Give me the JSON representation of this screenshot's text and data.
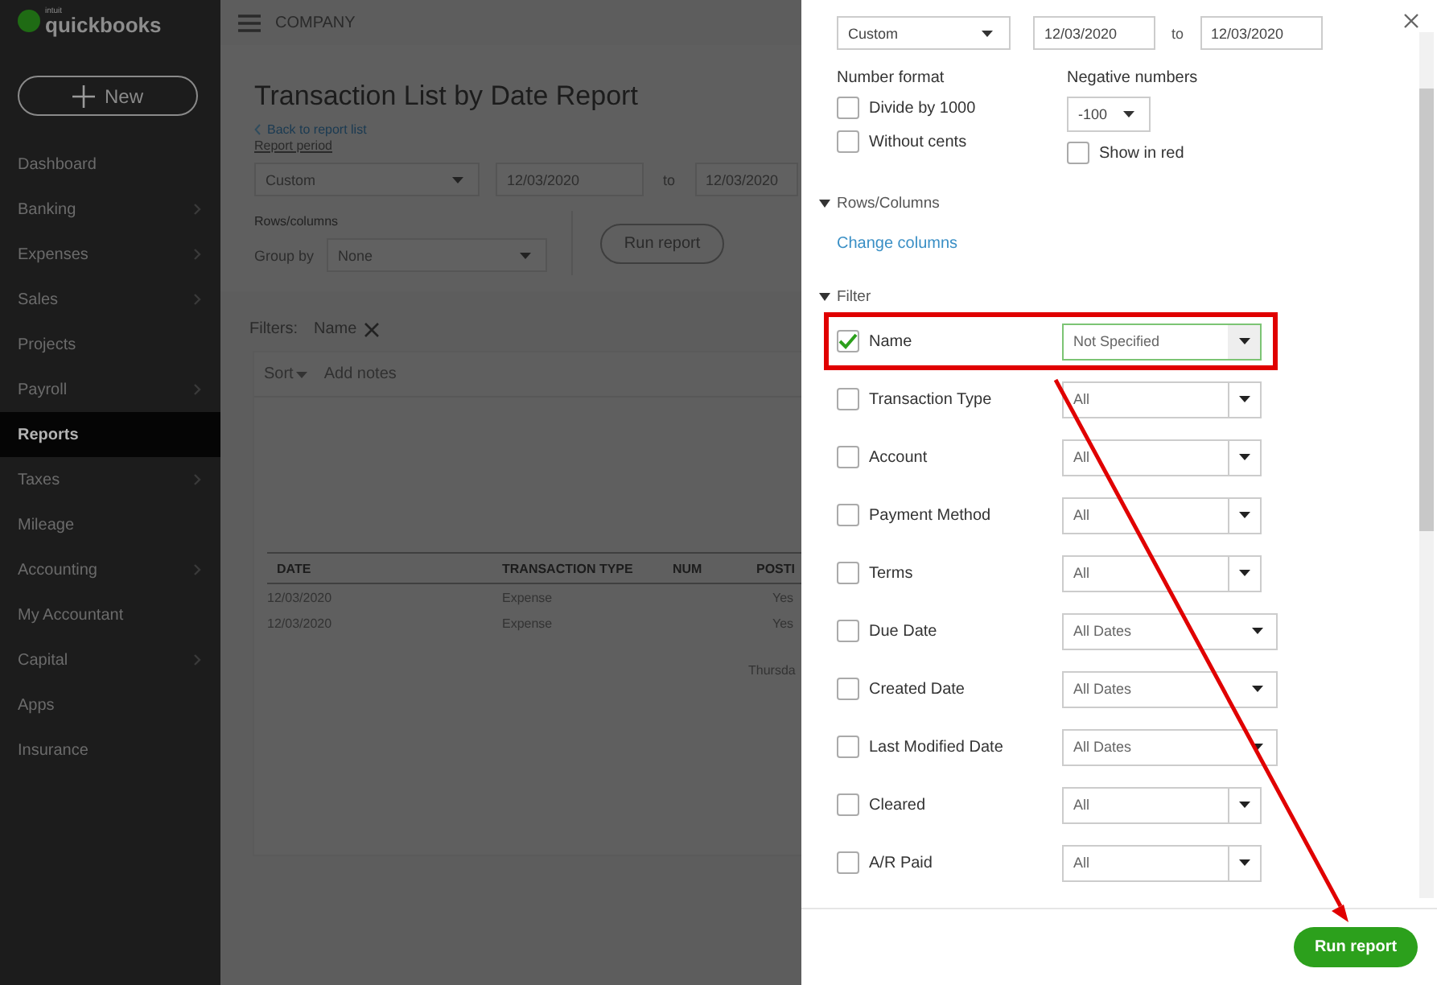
{
  "app": {
    "logo_small": "intuit",
    "logo": "quickbooks",
    "new_button": "New"
  },
  "sidebar": {
    "items": [
      {
        "label": "Dashboard",
        "submenu": false,
        "selected": false
      },
      {
        "label": "Banking",
        "submenu": true,
        "selected": false
      },
      {
        "label": "Expenses",
        "submenu": true,
        "selected": false
      },
      {
        "label": "Sales",
        "submenu": true,
        "selected": false
      },
      {
        "label": "Projects",
        "submenu": false,
        "selected": false
      },
      {
        "label": "Payroll",
        "submenu": true,
        "selected": false
      },
      {
        "label": "Reports",
        "submenu": false,
        "selected": true
      },
      {
        "label": "Taxes",
        "submenu": true,
        "selected": false
      },
      {
        "label": "Mileage",
        "submenu": false,
        "selected": false
      },
      {
        "label": "Accounting",
        "submenu": true,
        "selected": false
      },
      {
        "label": "My Accountant",
        "submenu": false,
        "selected": false
      },
      {
        "label": "Capital",
        "submenu": true,
        "selected": false
      },
      {
        "label": "Apps",
        "submenu": false,
        "selected": false
      },
      {
        "label": "Insurance",
        "submenu": false,
        "selected": false
      }
    ]
  },
  "topbar": {
    "company": "COMPANY"
  },
  "report": {
    "title": "Transaction List by Date Report",
    "back_link": "Back to report list",
    "period_label": "Report period",
    "period": "Custom",
    "from": "12/03/2020",
    "to_label": "to",
    "to": "12/03/2020",
    "rows_columns_label": "Rows/columns",
    "group_by_label": "Group by",
    "group_by": "None",
    "run_button": "Run report",
    "filters_label": "Filters:",
    "filter_chip": "Name",
    "sort": "Sort",
    "add_notes": "Add notes",
    "table": {
      "columns": [
        "DATE",
        "TRANSACTION TYPE",
        "NUM",
        "POSTI"
      ],
      "rows": [
        [
          "12/03/2020",
          "Expense",
          "",
          "Yes"
        ],
        [
          "12/03/2020",
          "Expense",
          "",
          "Yes"
        ]
      ]
    },
    "footer_text": "Thursda"
  },
  "panel": {
    "period": "Custom",
    "from": "12/03/2020",
    "to_label": "to",
    "to": "12/03/2020",
    "number_format": {
      "label": "Number format",
      "options": [
        {
          "label": "Divide by 1000",
          "checked": false
        },
        {
          "label": "Without cents",
          "checked": false
        }
      ]
    },
    "negative": {
      "label": "Negative numbers",
      "value": "-100",
      "show_red": {
        "label": "Show in red",
        "checked": false
      }
    },
    "rows_columns": {
      "label": "Rows/Columns",
      "expanded": true,
      "link": "Change columns"
    },
    "filter": {
      "label": "Filter",
      "expanded": true
    },
    "filters": [
      {
        "label": "Name",
        "checked": true,
        "value": "Not Specified",
        "kind": "list",
        "highlighted": true
      },
      {
        "label": "Transaction Type",
        "checked": false,
        "value": "All",
        "kind": "list",
        "highlighted": false
      },
      {
        "label": "Account",
        "checked": false,
        "value": "All",
        "kind": "list",
        "highlighted": false
      },
      {
        "label": "Payment Method",
        "checked": false,
        "value": "All",
        "kind": "list",
        "highlighted": false
      },
      {
        "label": "Terms",
        "checked": false,
        "value": "All",
        "kind": "list",
        "highlighted": false
      },
      {
        "label": "Due Date",
        "checked": false,
        "value": "All Dates",
        "kind": "date",
        "highlighted": false
      },
      {
        "label": "Created Date",
        "checked": false,
        "value": "All Dates",
        "kind": "date",
        "highlighted": false
      },
      {
        "label": "Last Modified Date",
        "checked": false,
        "value": "All Dates",
        "kind": "date",
        "highlighted": false
      },
      {
        "label": "Cleared",
        "checked": false,
        "value": "All",
        "kind": "list",
        "highlighted": false
      },
      {
        "label": "A/R Paid",
        "checked": false,
        "value": "All",
        "kind": "list",
        "highlighted": false
      }
    ],
    "run_button": "Run report"
  }
}
